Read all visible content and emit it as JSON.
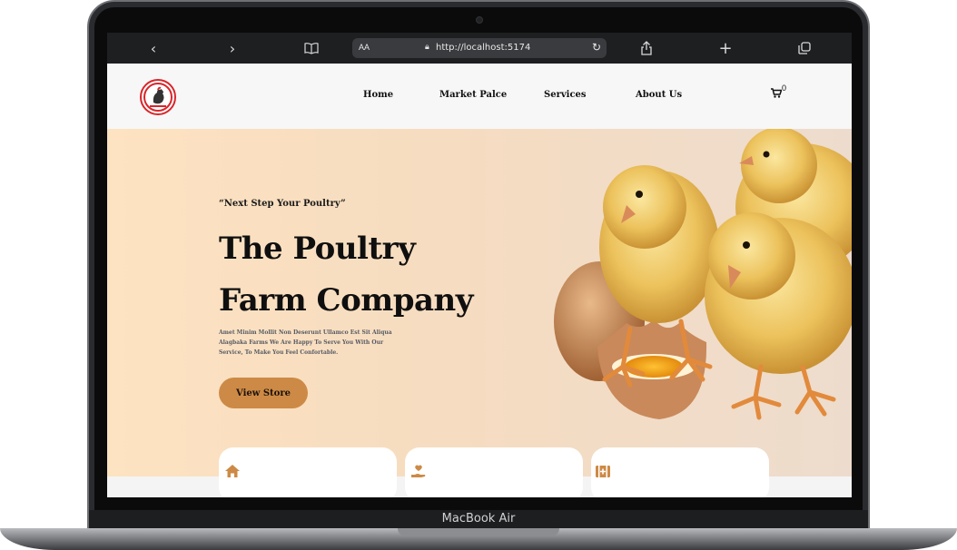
{
  "device": {
    "label": "MacBook Air"
  },
  "browser": {
    "url_prefix": "AA",
    "url": "http://localhost:5174",
    "icons": [
      "back-icon",
      "forward-icon",
      "reader-icon",
      "lock-icon",
      "reload-icon",
      "share-icon",
      "new-tab-icon",
      "tabs-icon"
    ]
  },
  "header": {
    "logo_text": "ALAGBAKA FARMS",
    "nav": [
      "Home",
      "Market Palce",
      "Services",
      "About Us"
    ],
    "cart_count": "0"
  },
  "hero": {
    "tagline": "“Next Step Your Poultry”",
    "title_line1": "The Poultry",
    "title_line2": "Farm Company",
    "description": "Amet Minim Mollit Non Deserunt Ullamco Est Sit Aliqua Alagbaka Farms We Are Happy To Serve You With Our Service, To Make You Feel Confortable.",
    "cta_label": "View Store"
  },
  "cards": [
    {
      "icon": "home-icon"
    },
    {
      "icon": "hand-heart-icon"
    },
    {
      "icon": "medical-kit-icon"
    }
  ],
  "colors": {
    "accent": "#cd8a46",
    "hero_bg": "#fde3c1",
    "toolbar_bg": "#1e1f21"
  }
}
